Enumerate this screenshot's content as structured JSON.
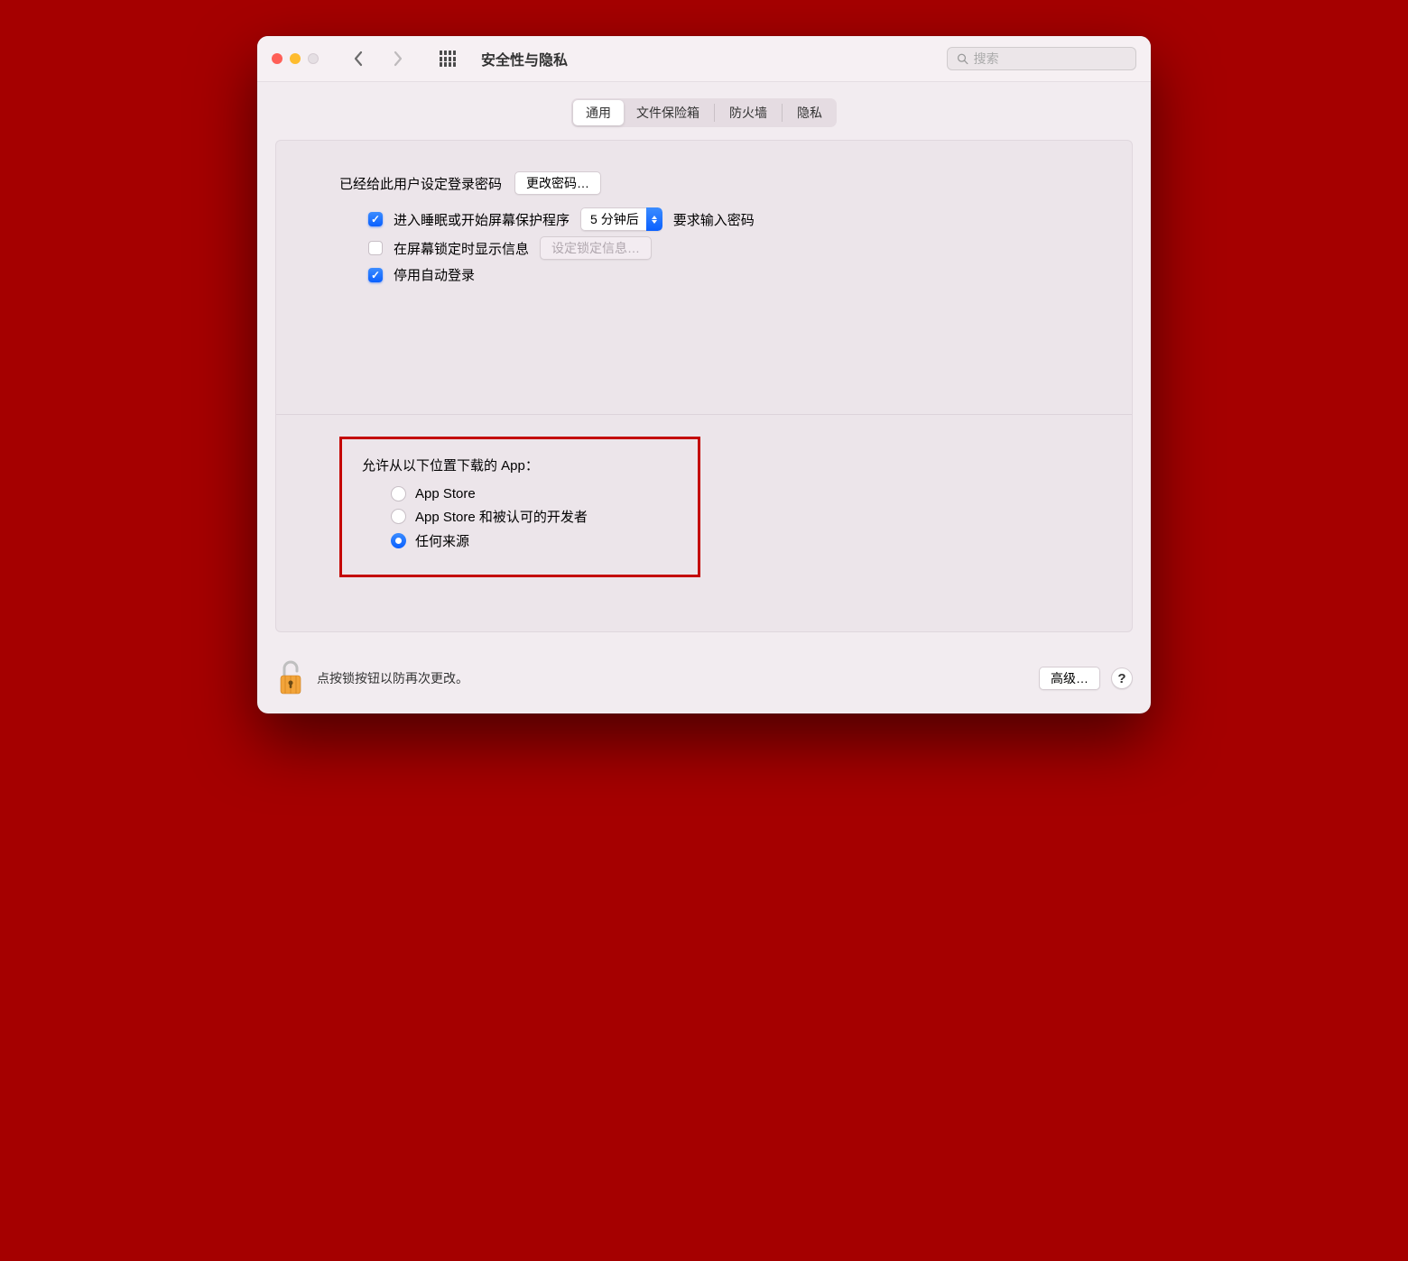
{
  "window": {
    "title": "安全性与隐私",
    "search_placeholder": "搜索"
  },
  "tabs": [
    {
      "label": "通用",
      "active": true
    },
    {
      "label": "文件保险箱",
      "active": false
    },
    {
      "label": "防火墙",
      "active": false
    },
    {
      "label": "隐私",
      "active": false
    }
  ],
  "general": {
    "login_password_set_text": "已经给此用户设定登录密码",
    "change_password_btn": "更改密码…",
    "require_password_prefix": "进入睡眠或开始屏幕保护程序",
    "require_password_delay": "5 分钟后",
    "require_password_suffix": "要求输入密码",
    "require_password_checked": true,
    "show_lock_message_label": "在屏幕锁定时显示信息",
    "show_lock_message_checked": false,
    "set_lock_message_btn": "设定锁定信息…",
    "disable_auto_login_label": "停用自动登录",
    "disable_auto_login_checked": true
  },
  "download": {
    "heading": "允许从以下位置下载的 App：",
    "options": [
      {
        "label": "App Store",
        "selected": false
      },
      {
        "label": "App Store 和被认可的开发者",
        "selected": false
      },
      {
        "label": "任何来源",
        "selected": true
      }
    ]
  },
  "footer": {
    "lock_text": "点按锁按钮以防再次更改。",
    "advanced_btn": "高级…",
    "help": "?"
  }
}
